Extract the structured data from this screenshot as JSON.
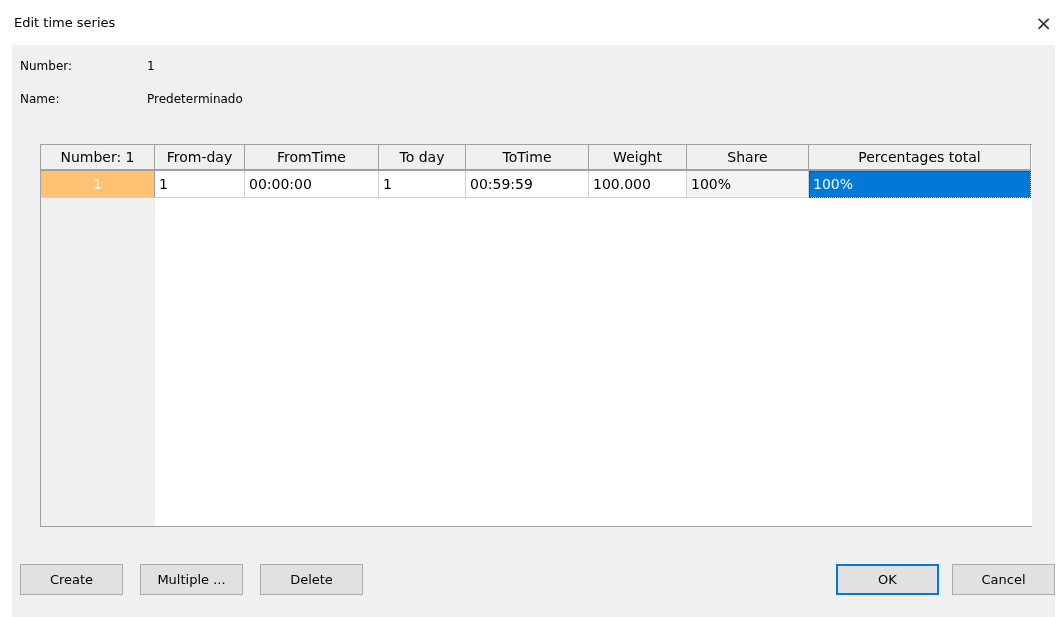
{
  "window": {
    "title": "Edit time series",
    "close": "×"
  },
  "fields": [
    {
      "label": "Number:",
      "value": "1"
    },
    {
      "label": "Name:",
      "value": "Predeterminado"
    }
  ],
  "table": {
    "columns": [
      "Number: 1",
      "From-day",
      "FromTime",
      "To day",
      "ToTime",
      "Weight",
      "Share",
      "Percentages total"
    ],
    "rows": [
      {
        "cells": [
          {
            "text": "1",
            "kind": "rowheader",
            "selected": true
          },
          {
            "text": "1",
            "kind": "edit",
            "selected": false
          },
          {
            "text": "00:00:00",
            "kind": "edit",
            "selected": false
          },
          {
            "text": "1",
            "kind": "edit",
            "selected": false
          },
          {
            "text": "00:59:59",
            "kind": "edit",
            "selected": false
          },
          {
            "text": "100.000",
            "kind": "edit",
            "selected": false
          },
          {
            "text": "100%",
            "kind": "readonly",
            "selected": false
          },
          {
            "text": "100%",
            "kind": "readonly",
            "selected": true
          }
        ]
      }
    ]
  },
  "buttons_left": [
    {
      "label": "Create",
      "default": false
    },
    {
      "label": "Multiple ...",
      "default": false
    },
    {
      "label": "Delete",
      "default": false
    }
  ],
  "buttons_right": [
    {
      "label": "OK",
      "default": true
    },
    {
      "label": "Cancel",
      "default": false
    }
  ]
}
